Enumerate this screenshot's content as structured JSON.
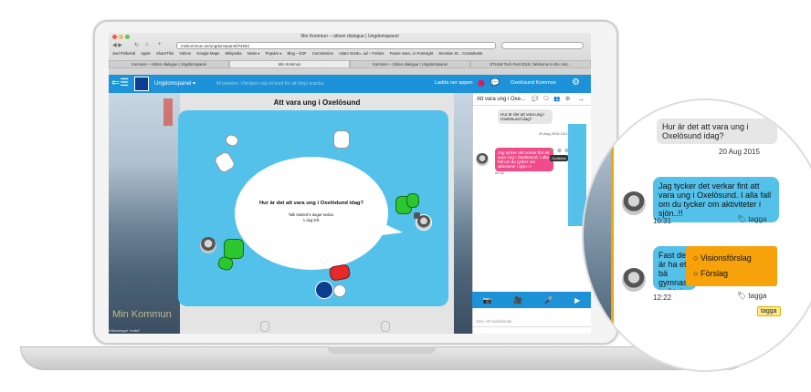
{
  "browser": {
    "window_title": "Min Kommun – citizen dialogue | Ungdomspanel",
    "url": "minkommun.se/ungdomspanel/#4694",
    "bookmarks": [
      "Joel Pinheiral",
      "Apple",
      "ShareThis",
      "Yahoo!",
      "Google Maps",
      "Wikipedia",
      "News ▾",
      "Popular ▾",
      "Blog – ESF",
      "Commission",
      "Adam Gordo...ad – Forbes",
      "Future Savv...in Foresight",
      "Decision St... Consultants"
    ],
    "tabs": [
      "Kommun – citizen dialogue | Ungdomspanel",
      "Min Kommun",
      "Kommun – citizen dialogue | Ungdomspanel",
      "STHLM Tech Fest 2015 | Welcome to the Unic..."
    ]
  },
  "appbar": {
    "panel_select": "Ungdomspanel",
    "subtitle": "till panelen. Vänligen välj ett bord för att börja snacka",
    "download_label": "Ladda ner appen",
    "municipality": "Oxelösund Kommun"
  },
  "main": {
    "title": "Att vara ung i Oxelösund",
    "question": "Hur är det att vara ung i Oxelödund idag?",
    "meta_line1": "Talk started 5 dagar sedan.",
    "meta_line2": "1 dag left.",
    "watermark": "Min Kommun",
    "status_bar": "Wikiantaget \"mobil\""
  },
  "chat": {
    "title": "Att vara ung i Oxe...",
    "messages": [
      {
        "text": "Hur är det att vara ung i Oxelösund idag?",
        "time": "20 Aug 2015 13:23"
      },
      {
        "text": "Jag tycker det verkar fint att vara ung i Oxelösund. I alla fall om du tycker om aktiviteter i sjön..!!",
        "time": "09:32"
      }
    ],
    "tooltip": "Godkänn",
    "input_placeholder": "Skriv ett meddelande"
  },
  "zoom": {
    "time_top": "20 Aug 2015",
    "msg_top": "Hur är det att vara ung i Oxelösund idag?",
    "msg1": "Jag tycker det verkar fint att vara ung i Oxelösund. I alla fall om du tycker om aktiviteter i sjön..!!",
    "time1": "10:31",
    "tag1": "tagga",
    "msg2": "Fast det är ha ett bä gymnasi inriktning",
    "time2": "12:22",
    "tag2": "tagga",
    "tag_tip": "tagga",
    "menu": [
      "Visionsförslag",
      "Förslag"
    ]
  },
  "colors": {
    "accent": "#1e92d8",
    "board": "#53c1ea",
    "menu": "#f7a20b",
    "chip_green": "#2cc72e",
    "chip_red": "#e52a2a"
  }
}
